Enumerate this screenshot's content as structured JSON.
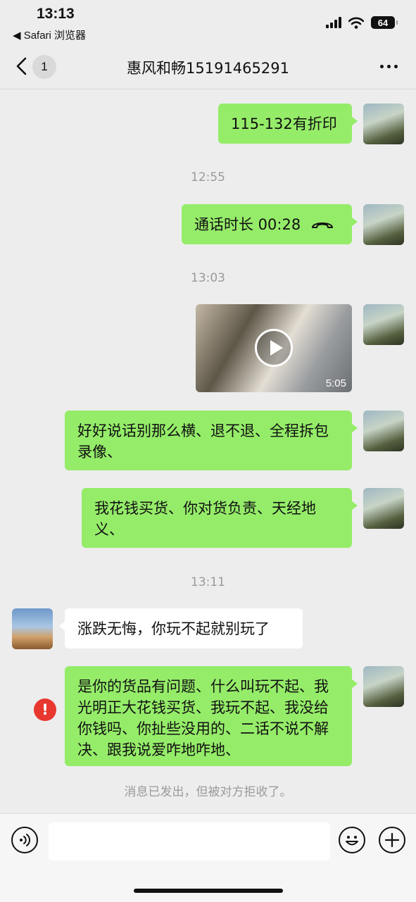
{
  "status": {
    "time": "13:13",
    "back_app": "◀ Safari 浏览器",
    "battery": "64"
  },
  "header": {
    "unread_count": "1",
    "title": "惠风和畅15191465291"
  },
  "messages": [
    {
      "side": "me",
      "text": "115-132有折印"
    },
    {
      "timestamp": "12:55"
    },
    {
      "side": "me",
      "type": "call",
      "text": "通话时长 00:28"
    },
    {
      "timestamp": "13:03"
    },
    {
      "side": "me",
      "type": "video",
      "duration": "5:05"
    },
    {
      "side": "me",
      "text": "好好说话别那么横、退不退、全程拆包录像、"
    },
    {
      "side": "me",
      "text": "我花钱买货、你对货负责、天经地义、"
    },
    {
      "timestamp": "13:11"
    },
    {
      "side": "other",
      "text": "涨跌无悔，你玩不起就别玩了"
    },
    {
      "side": "me",
      "text": "是你的货品有问题、什么叫玩不起、我光明正大花钱买货、我玩不起、我没给你钱吗、你扯些没用的、二话不说不解决、跟我说爱咋地咋地、",
      "failed": true
    }
  ],
  "rejected_notice": "消息已发出，但被对方拒收了。",
  "icons": {
    "back": "chevron-left-icon",
    "more": "more-dots-icon",
    "hangup": "phone-hangup-icon",
    "play": "play-icon",
    "error": "error-icon",
    "voice": "voice-icon",
    "emoji": "emoji-icon",
    "plus": "plus-icon"
  },
  "colors": {
    "my_bubble": "#95ec69",
    "other_bubble": "#ffffff",
    "background": "#ededed",
    "error": "#e8372f"
  }
}
